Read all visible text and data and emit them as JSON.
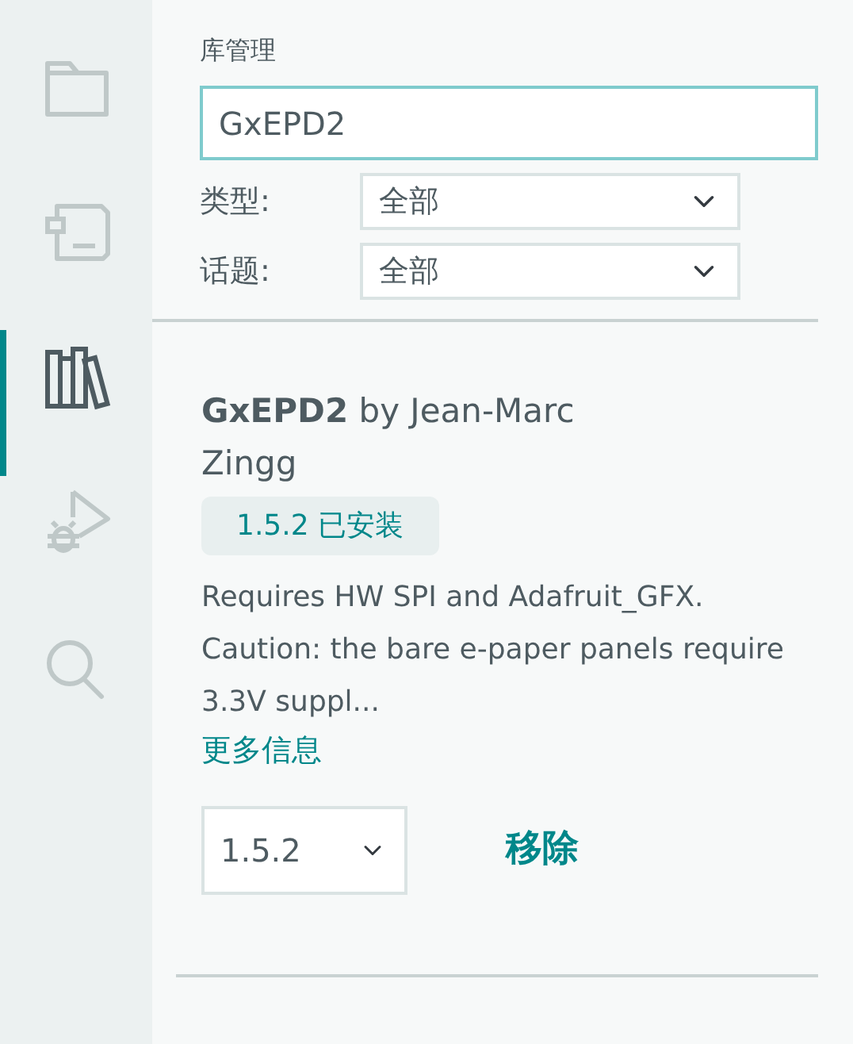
{
  "sidebar": {
    "items": [
      {
        "kind": "folder",
        "selected": false
      },
      {
        "kind": "board",
        "selected": false
      },
      {
        "kind": "library",
        "selected": true
      },
      {
        "kind": "debug",
        "selected": false
      },
      {
        "kind": "search",
        "selected": false
      }
    ]
  },
  "panel": {
    "title": "库管理",
    "search": {
      "value": "GxEPD2"
    },
    "filters": [
      {
        "label": "类型:",
        "value": "全部"
      },
      {
        "label": "话题:",
        "value": "全部"
      }
    ],
    "library": {
      "title": "**GxEPD2** by Jean-Marc Zingg",
      "badge": "1.5.2 已安装",
      "description": "Requires HW SPI and Adafruit_GFX. Caution: the bare e-paper panels require 3.3V suppl...",
      "more_info": "更多信息",
      "version": "1.5.2",
      "remove_button": "移除"
    }
  }
}
